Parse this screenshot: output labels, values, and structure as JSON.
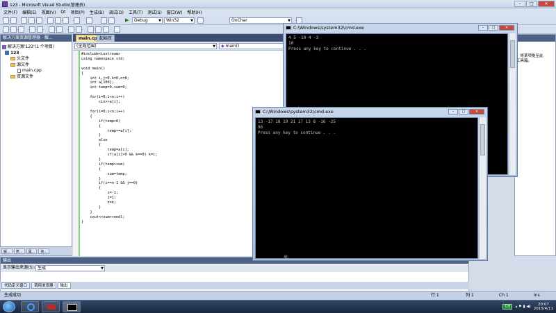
{
  "window": {
    "title": "123 - Microsoft Visual Studio(管理员)"
  },
  "menu": [
    "文件(F)",
    "编辑(E)",
    "视图(V)",
    "Qt",
    "项目(P)",
    "生成(B)",
    "调试(D)",
    "工具(T)",
    "测试(S)",
    "窗口(W)",
    "帮助(H)"
  ],
  "toolbar": {
    "config": "Debug",
    "platform": "Win32",
    "function": "OnChar"
  },
  "solution_explorer": {
    "title": "解决方案资源管理器 - 解...",
    "items": [
      {
        "label": "解决方案'123'(1 个项目)",
        "icon": "solution-icon"
      },
      {
        "label": "123",
        "icon": "project-icon"
      },
      {
        "label": "头文件",
        "icon": "folder-icon"
      },
      {
        "label": "源文件",
        "icon": "folder-icon"
      },
      {
        "label": "main.cpp",
        "icon": "file-icon"
      },
      {
        "label": "资源文件",
        "icon": "folder-icon"
      }
    ],
    "bottom_tabs": [
      "解...",
      "类...",
      "属...",
      "资..."
    ]
  },
  "editor": {
    "tabs": [
      "main.cpp",
      "起始页"
    ],
    "scope": "(全局范围)",
    "member": "main()",
    "code": [
      "#include<iostream>",
      "using namespace std;",
      "",
      "void main()",
      "{",
      "    int i,j=0,k=0,n=8;",
      "    int a[100];",
      "    int temp=0,sum=0;",
      "",
      "    for(i=0;i<n;i++)",
      "        cin>>a[i];",
      "",
      "    for(i=0;i<n;i++)",
      "    {",
      "        if(temp>0)",
      "        {",
      "            temp+=a[i];",
      "        }",
      "        else",
      "        {",
      "            temp=a[i];",
      "            if(a[i]>0 && k==0) k=i;",
      "        }",
      "        if(temp>sum)",
      "        {",
      "            sum=temp;",
      "        }",
      "        if(i==n-1 && j==0)",
      "        {",
      "            i=-1;",
      "            j=1;",
      "            n=k;",
      "        }",
      "    }",
      "    cout<<sum<<endl;",
      "}"
    ]
  },
  "right_panel": {
    "text": [
      "，将某项拖至此",
      "工具箱。"
    ]
  },
  "output": {
    "title": "输出",
    "show_from_label": "显示输出来源(S):",
    "source": "生成"
  },
  "bottom_tabs": [
    "代码定义窗口",
    "调用浏览器",
    "输出"
  ],
  "status": {
    "left": "生成成功",
    "line": "行 1",
    "col": "列 1",
    "ch": "Ch 1",
    "mode": "Ins"
  },
  "cmd1": {
    "title": "C:\\Windows\\system32\\cmd.exe",
    "lines": [
      "4 5 -10 4 -3",
      "10",
      "Press any key to continue . . ."
    ]
  },
  "cmd2": {
    "title": "C:\\Windows\\system32\\cmd.exe",
    "lines": [
      "13 -17 18 19 21 17 13 8 -16 -25",
      "96",
      "Press any key to continue . . ."
    ],
    "cursor_glyph": "半:"
  },
  "taskbar": {
    "ime": "CH",
    "time": "20:07",
    "date": "2015/4/11"
  }
}
